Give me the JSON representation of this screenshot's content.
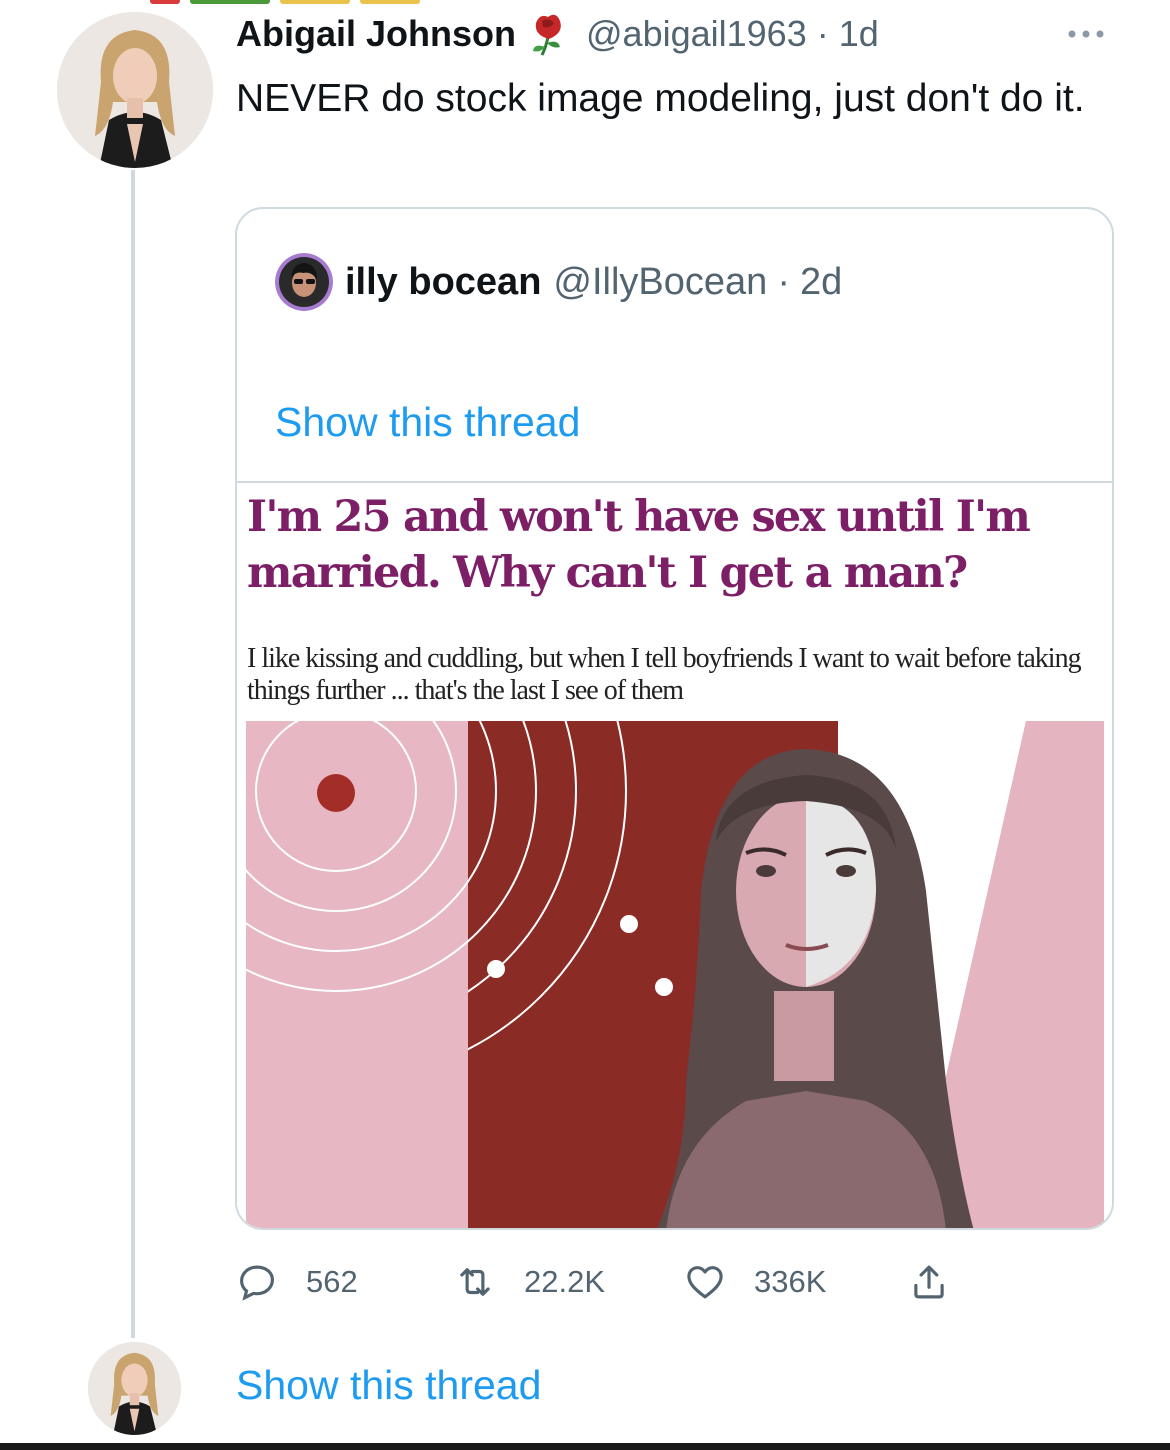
{
  "tweet": {
    "display_name": "Abigail Johnson",
    "verified_icon": "rose-icon",
    "handle": "@abigail1963",
    "separator": "·",
    "time": "1d",
    "more_icon": "more-dots-icon",
    "text": "NEVER do stock image modeling, just don't do it."
  },
  "quoted_tweet": {
    "display_name": "illy bocean",
    "handle": "@IllyBocean",
    "separator": "·",
    "time": "2d",
    "show_thread_label": "Show this thread",
    "article": {
      "headline": "I'm 25 and won't have sex until I'm married. Why can't I get a man?",
      "standfirst": "I like kissing and cuddling, but when I tell boyfriends I want to wait before taking things further ... that's the last I see of them"
    }
  },
  "actions": {
    "replies": "562",
    "retweets": "22.2K",
    "likes": "336K"
  },
  "footer": {
    "show_thread_label": "Show this thread"
  },
  "colors": {
    "link": "#1d9bf0",
    "secondary_text": "#536471",
    "headline": "#7d1f67",
    "image_pink": "#e7b7c3",
    "image_red": "#8b2b26"
  }
}
